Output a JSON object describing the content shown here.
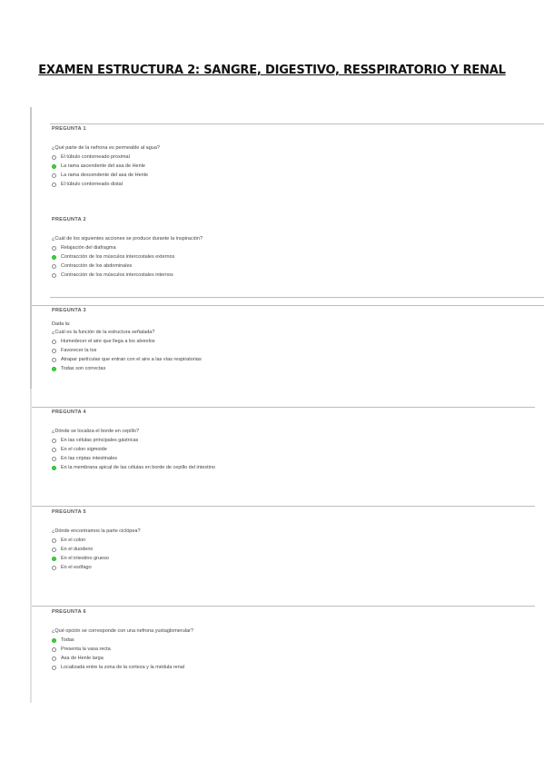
{
  "title": "EXAMEN ESTRUCTURA 2: SANGRE, DIGESTIVO, RESSPIRATORIO Y RENAL",
  "questions": [
    {
      "number": "PREGUNTA 1",
      "lines": [
        "¿Qué parte de la nefrona es permeable al agua?"
      ],
      "options": [
        {
          "label": "El túbulo contorneado proximal",
          "selected": false
        },
        {
          "label": "La rama ascendente del asa de Henle",
          "selected": true
        },
        {
          "label": "La rama descendente del asa de Henle",
          "selected": false
        },
        {
          "label": "El túbulo contorneado distal",
          "selected": false
        }
      ]
    },
    {
      "number": "PREGUNTA 2",
      "lines": [
        "¿Cuál de los siguientes acciones se produce durante la inspiración?"
      ],
      "options": [
        {
          "label": "Relajación del diafragma",
          "selected": false
        },
        {
          "label": "Contracción de los músculos intercostales externos",
          "selected": true
        },
        {
          "label": "Contracción de los abdominales",
          "selected": false
        },
        {
          "label": "Contracción de los músculos intercostales internos",
          "selected": false
        }
      ]
    },
    {
      "number": "PREGUNTA 3",
      "lines": [
        "Dada la:",
        "¿Cuál es la función de la estructura señalada?"
      ],
      "options": [
        {
          "label": "Humedecer el aire que llega a los alveolos",
          "selected": false
        },
        {
          "label": "Favorecer la tos",
          "selected": false
        },
        {
          "label": "Atrapar partículas que entran con el aire a las vías respiratorias",
          "selected": false
        },
        {
          "label": "Todas son correctas",
          "selected": true
        }
      ]
    },
    {
      "number": "PREGUNTA 4",
      "lines": [
        "¿Dónde se localiza el borde en cepillo?"
      ],
      "options": [
        {
          "label": "En las células principales gástricas",
          "selected": false
        },
        {
          "label": "En el colon sigmoide",
          "selected": false
        },
        {
          "label": "En las criptas intestinales",
          "selected": false
        },
        {
          "label": "En la membrana apical de las células en borde de cepillo del intestino",
          "selected": true
        }
      ]
    },
    {
      "number": "PREGUNTA 5",
      "lines": [
        "¿Dónde encontramos la parte ciclópea?"
      ],
      "options": [
        {
          "label": "En el colon",
          "selected": false
        },
        {
          "label": "En el duodeno",
          "selected": false
        },
        {
          "label": "En el intestino grueso",
          "selected": true
        },
        {
          "label": "En el esófago",
          "selected": false
        }
      ]
    },
    {
      "number": "PREGUNTA 6",
      "lines": [
        "¿Qué opción se corresponde con una nefrona yuxtaglomerular?"
      ],
      "options": [
        {
          "label": "Todas",
          "selected": true
        },
        {
          "label": "Presenta la vasa recta",
          "selected": false
        },
        {
          "label": "Asa de Henle larga",
          "selected": false
        },
        {
          "label": "Localizada entre la zona de la corteza y la médula renal",
          "selected": false
        }
      ]
    }
  ]
}
